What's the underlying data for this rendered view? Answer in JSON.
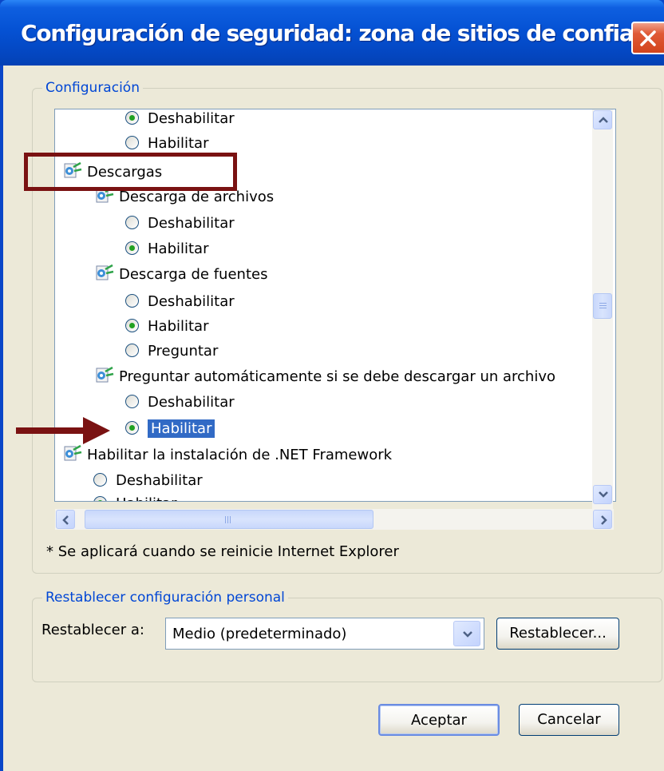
{
  "window": {
    "title": "Configuración de seguridad: zona de sitios de confianza",
    "close_icon": "close-icon"
  },
  "settings": {
    "group_label": "Configuración",
    "items": [
      {
        "type": "radio",
        "label": "Deshabilitar",
        "checked": true
      },
      {
        "type": "radio",
        "label": "Habilitar",
        "checked": false
      },
      {
        "type": "category",
        "label": "Descargas",
        "icon": "settings-gear-icon"
      },
      {
        "type": "category",
        "label": "Descarga de archivos",
        "icon": "settings-gear-icon"
      },
      {
        "type": "radio",
        "label": "Deshabilitar",
        "checked": false
      },
      {
        "type": "radio",
        "label": "Habilitar",
        "checked": true
      },
      {
        "type": "category",
        "label": "Descarga de fuentes",
        "icon": "settings-gear-icon"
      },
      {
        "type": "radio",
        "label": "Deshabilitar",
        "checked": false
      },
      {
        "type": "radio",
        "label": "Habilitar",
        "checked": true
      },
      {
        "type": "radio",
        "label": "Preguntar",
        "checked": false
      },
      {
        "type": "category",
        "label": "Preguntar automáticamente si se debe descargar un archivo",
        "icon": "settings-gear-icon"
      },
      {
        "type": "radio",
        "label": "Deshabilitar",
        "checked": false
      },
      {
        "type": "radio",
        "label": "Habilitar",
        "checked": true,
        "selected": true
      },
      {
        "type": "category",
        "label": "Habilitar la instalación de .NET Framework",
        "icon": "settings-gear-icon"
      },
      {
        "type": "radio",
        "label": "Deshabilitar",
        "checked": false
      },
      {
        "type": "radio",
        "label": "Habilitar",
        "checked": true
      }
    ],
    "note": "* Se aplicará cuando se reinicie Internet Explorer"
  },
  "reset": {
    "group_label": "Restablecer configuración personal",
    "label": "Restablecer a:",
    "selected_value": "Medio (predeterminado)",
    "button": "Restablecer..."
  },
  "footer": {
    "ok": "Aceptar",
    "cancel": "Cancelar"
  },
  "colors": {
    "title_bar": "#0552d4",
    "dialog_bg": "#ece9d8",
    "selection": "#316ac5",
    "annotation": "#7a1212"
  }
}
